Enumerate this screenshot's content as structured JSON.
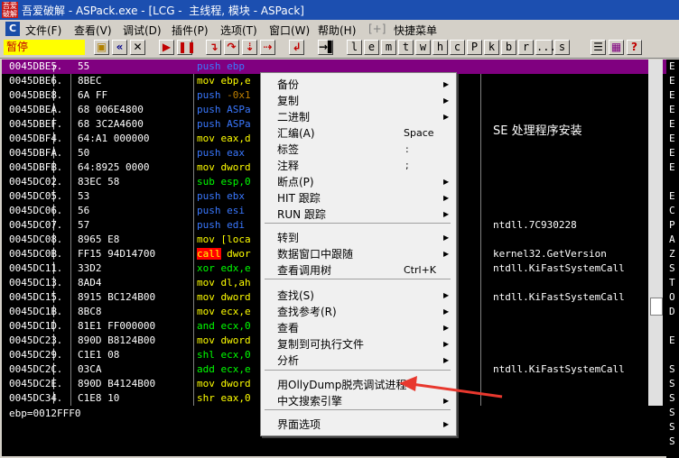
{
  "window": {
    "title": "吾爱破解 - ASPack.exe - [LCG -  主线程, 模块 - ASPack]",
    "app_icon_text": "吾爱破解"
  },
  "menubar": {
    "items": [
      "文件(F)",
      "查看(V)",
      "调试(D)",
      "插件(P)",
      "选项(T)",
      "窗口(W)",
      "帮助(H)",
      "[+]",
      "快捷菜单"
    ]
  },
  "toolbar": {
    "status": "暂停",
    "letters": [
      "l",
      "e",
      "m",
      "t",
      "w",
      "h",
      "c",
      "P",
      "k",
      "b",
      "r",
      "...",
      "s"
    ]
  },
  "disasm": {
    "rows": [
      {
        "addr": "0045DBE5",
        "mark": "┌.",
        "hex": "55",
        "op": "push",
        "args": "ebp",
        "cmt": ""
      },
      {
        "addr": "0045DBE6",
        "mark": "│.",
        "hex": "8BEC",
        "op": "mov",
        "args": "ebp,e",
        "cmt": ""
      },
      {
        "addr": "0045DBE8",
        "mark": "│.",
        "hex": "6A FF",
        "op": "push",
        "args": "-0x1",
        "cmt": ""
      },
      {
        "addr": "0045DBEA",
        "mark": "│.",
        "hex": "68 006E4800",
        "op": "push",
        "args": "ASPa",
        "cmt": ""
      },
      {
        "addr": "0045DBEF",
        "mark": "│.",
        "hex": "68 3C2A4600",
        "op": "push",
        "args": "ASPa",
        "cmt": "SE 处理程序安装"
      },
      {
        "addr": "0045DBF4",
        "mark": "│.",
        "hex": "64:A1 000000",
        "op": "mov",
        "args": "eax,d",
        "cmt": ""
      },
      {
        "addr": "0045DBFA",
        "mark": "│.",
        "hex": "50",
        "op": "push",
        "args": "eax",
        "cmt": ""
      },
      {
        "addr": "0045DBFB",
        "mark": "│.",
        "hex": "64:8925 0000",
        "op": "mov",
        "args": "dword",
        "cmt": ""
      },
      {
        "addr": "0045DC02",
        "mark": "│.",
        "hex": "83EC 58",
        "op": "sub",
        "args": "esp,0",
        "cmt": ""
      },
      {
        "addr": "0045DC05",
        "mark": "│.",
        "hex": "53",
        "op": "push",
        "args": "ebx",
        "cmt": ""
      },
      {
        "addr": "0045DC06",
        "mark": "│.",
        "hex": "56",
        "op": "push",
        "args": "esi",
        "cmt": ""
      },
      {
        "addr": "0045DC07",
        "mark": "│.",
        "hex": "57",
        "op": "push",
        "args": "edi",
        "cmt": "ntdll.7C930228"
      },
      {
        "addr": "0045DC08",
        "mark": "│.",
        "hex": "8965 E8",
        "op": "mov",
        "args": "[loca",
        "cmt": ""
      },
      {
        "addr": "0045DC0B",
        "mark": "│.",
        "hex": "FF15 94D14700",
        "op": "call",
        "args": "dwor",
        "cmt": "kernel32.GetVersion"
      },
      {
        "addr": "0045DC11",
        "mark": "│.",
        "hex": "33D2",
        "op": "xor",
        "args": "edx,e",
        "cmt": "ntdll.KiFastSystemCall"
      },
      {
        "addr": "0045DC13",
        "mark": "│.",
        "hex": "8AD4",
        "op": "mov",
        "args": "dl,ah",
        "cmt": ""
      },
      {
        "addr": "0045DC15",
        "mark": "│.",
        "hex": "8915 BC124B00",
        "op": "mov",
        "args": "dword",
        "cmt": "ntdll.KiFastSystemCall"
      },
      {
        "addr": "0045DC1B",
        "mark": "│.",
        "hex": "8BC8",
        "op": "mov",
        "args": "ecx,e",
        "cmt": ""
      },
      {
        "addr": "0045DC1D",
        "mark": "│.",
        "hex": "81E1 FF000000",
        "op": "and",
        "args": "ecx,0",
        "cmt": ""
      },
      {
        "addr": "0045DC23",
        "mark": "│.",
        "hex": "890D B8124B00",
        "op": "mov",
        "args": "dword",
        "cmt": ""
      },
      {
        "addr": "0045DC29",
        "mark": "│.",
        "hex": "C1E1 08",
        "op": "shl",
        "args": "ecx,0",
        "cmt": ""
      },
      {
        "addr": "0045DC2C",
        "mark": "│.",
        "hex": "03CA",
        "op": "add",
        "args": "ecx,e",
        "cmt": "ntdll.KiFastSystemCall"
      },
      {
        "addr": "0045DC2E",
        "mark": "│.",
        "hex": "890D B4124B00",
        "op": "mov",
        "args": "dword",
        "cmt": ""
      },
      {
        "addr": "0045DC34",
        "mark": "│.",
        "hex": "C1E8 10",
        "op": "shr",
        "args": "eax,0",
        "cmt": ""
      }
    ]
  },
  "right_panel": {
    "letters": [
      "E",
      "E",
      "E",
      "E",
      "E",
      "E",
      "E",
      "E",
      "",
      "E",
      "C",
      "P",
      "A",
      "Z",
      "S",
      "T",
      "O",
      "D",
      "",
      "E",
      "",
      "S",
      "S",
      "S",
      "S",
      "S",
      "S"
    ]
  },
  "info": {
    "text": "ebp=0012FFF0"
  },
  "context_menu": {
    "items": [
      {
        "label": "备份",
        "shortcut": "",
        "submenu": true
      },
      {
        "label": "复制",
        "shortcut": "",
        "submenu": true
      },
      {
        "label": "二进制",
        "shortcut": "",
        "submenu": true
      },
      {
        "label": "汇编(A)",
        "shortcut": "Space",
        "submenu": false
      },
      {
        "label": "标签",
        "shortcut": ":",
        "submenu": false
      },
      {
        "label": "注释",
        "shortcut": ";",
        "submenu": false
      },
      {
        "label": "断点(P)",
        "shortcut": "",
        "submenu": true
      },
      {
        "label": "HIT 跟踪",
        "shortcut": "",
        "submenu": true
      },
      {
        "label": "RUN 跟踪",
        "shortcut": "",
        "submenu": true
      },
      {
        "label": "转到",
        "shortcut": "",
        "submenu": true
      },
      {
        "label": "数据窗口中跟随",
        "shortcut": "",
        "submenu": true
      },
      {
        "label": "查看调用树",
        "shortcut": "Ctrl+K",
        "submenu": false
      },
      {
        "label": "查找(S)",
        "shortcut": "",
        "submenu": true
      },
      {
        "label": "查找参考(R)",
        "shortcut": "",
        "submenu": true
      },
      {
        "label": "查看",
        "shortcut": "",
        "submenu": true
      },
      {
        "label": "复制到可执行文件",
        "shortcut": "",
        "submenu": true
      },
      {
        "label": "分析",
        "shortcut": "",
        "submenu": true
      },
      {
        "label": "用OllyDump脱壳调试进程",
        "shortcut": "",
        "submenu": false
      },
      {
        "label": "中文搜索引擎",
        "shortcut": "",
        "submenu": true
      },
      {
        "label": "界面选项",
        "shortcut": "",
        "submenu": true
      }
    ]
  },
  "colors": {
    "title_bar": "#1c4fb0",
    "selection": "#800080",
    "push": "#3a78ff",
    "mov": "#ffff00",
    "call_bg": "#ff0000",
    "call_fg": "#ffff00",
    "arith": "#00ff00",
    "annotation_arrow": "#e8382e"
  }
}
